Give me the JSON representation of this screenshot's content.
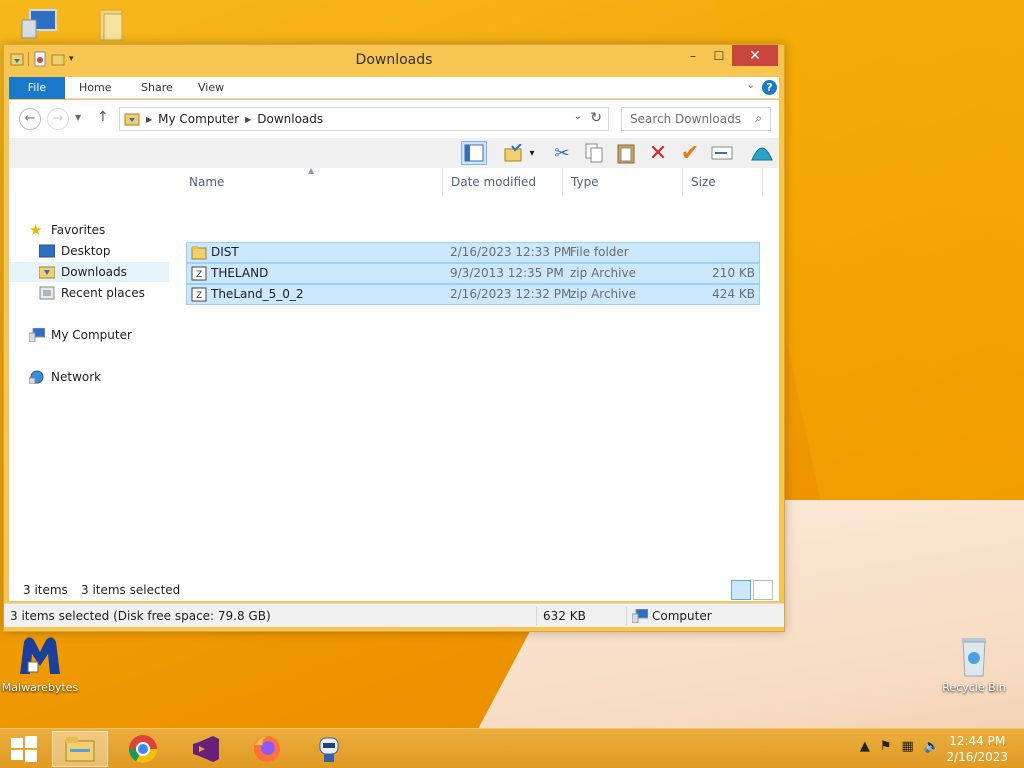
{
  "desktop": {
    "icons": [
      {
        "label": "Malwarebytes"
      },
      {
        "label": "Recycle Bin"
      }
    ]
  },
  "window": {
    "title": "Downloads",
    "caption": {
      "minimize": "–",
      "maximize": "☐",
      "close": "✕"
    },
    "ribbon_tabs": [
      "File",
      "Home",
      "Share",
      "View"
    ],
    "help": "?",
    "address": {
      "crumbs": [
        "My Computer",
        "Downloads"
      ]
    },
    "search": {
      "placeholder": "Search Downloads"
    },
    "nav_pane": {
      "favorites": "Favorites",
      "desktop": "Desktop",
      "downloads": "Downloads",
      "recent": "Recent places",
      "computer": "My Computer",
      "network": "Network"
    },
    "columns": [
      "Name",
      "Date modified",
      "Type",
      "Size"
    ],
    "files": [
      {
        "name": "DIST",
        "date": "2/16/2023 12:33 PM",
        "type": "File folder",
        "size": ""
      },
      {
        "name": "THELAND",
        "date": "9/3/2013 12:35 PM",
        "type": "zip Archive",
        "size": "210 KB"
      },
      {
        "name": "TheLand_5_0_2",
        "date": "2/16/2023 12:32 PM",
        "type": "zip Archive",
        "size": "424 KB"
      }
    ],
    "status": {
      "items": "3 items",
      "selected": "3 items selected",
      "detail": "3 items selected (Disk free space: 79.8 GB)",
      "size": "632 KB",
      "location": "Computer"
    }
  },
  "taskbar": {
    "clock_time": "12:44 PM",
    "clock_date": "2/16/2023"
  },
  "colors": {
    "accent": "#1979ca",
    "selection": "#cce8ff",
    "window_frame": "#f7c652",
    "close_button": "#c9463d"
  }
}
